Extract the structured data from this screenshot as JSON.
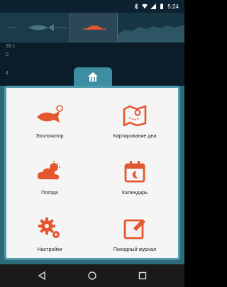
{
  "status_bar": {
    "time": "5:24"
  },
  "sonar": {
    "depth_labels": [
      "39.1",
      "0",
      "4"
    ]
  },
  "menu": {
    "items": [
      {
        "label": "Эхолокатор",
        "icon": "fish-sonar-icon"
      },
      {
        "label": "Картирование дна",
        "icon": "bottom-mapping-icon"
      },
      {
        "label": "Погода",
        "icon": "weather-cloud-icon"
      },
      {
        "label": "Календарь",
        "icon": "calendar-icon"
      },
      {
        "label": "Настройки",
        "icon": "gear-icon"
      },
      {
        "label": "Походный журнал",
        "icon": "journal-pencil-icon"
      }
    ]
  },
  "colors": {
    "accent": "#e4572e",
    "tab": "#3d8ea0",
    "overlay": "#2d6a79"
  }
}
